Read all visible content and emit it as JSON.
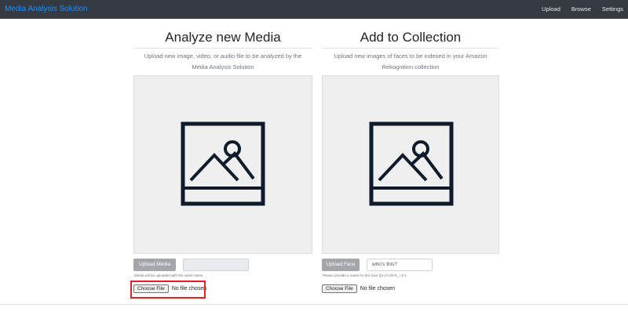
{
  "navbar": {
    "brand": "Media Analysis Solution",
    "links": [
      "Upload",
      "Browse",
      "Settings"
    ]
  },
  "analyze": {
    "title": "Analyze new Media",
    "description_line1": "Upload new image, video, or audio file to be analyzed by the",
    "description_line2": "Media Analysis Solution",
    "upload_button": "Upload Media",
    "name_value": "",
    "hint": "Media will be uploaded with the same name",
    "choose_file": "Choose File",
    "no_file": "No file chosen"
  },
  "collection": {
    "title": "Add to Collection",
    "description_line1": "Upload new images of faces to be indexed in your Amazon",
    "description_line2": "Rekognition collection",
    "upload_button": "Upload Face",
    "name_placeholder": "who's this?",
    "hint": "Please provide a name for this face ([a-zA-Z0-9_.\\-]+)",
    "choose_file": "Choose File",
    "no_file": "No file chosen"
  },
  "colors": {
    "navbar": "#343a40",
    "brand": "#1f8fff",
    "highlight": "#e0211c",
    "placeholder_bg": "#efefef",
    "icon_stroke": "#0f1b2a"
  },
  "icons": {
    "preview": "image-placeholder-icon"
  }
}
